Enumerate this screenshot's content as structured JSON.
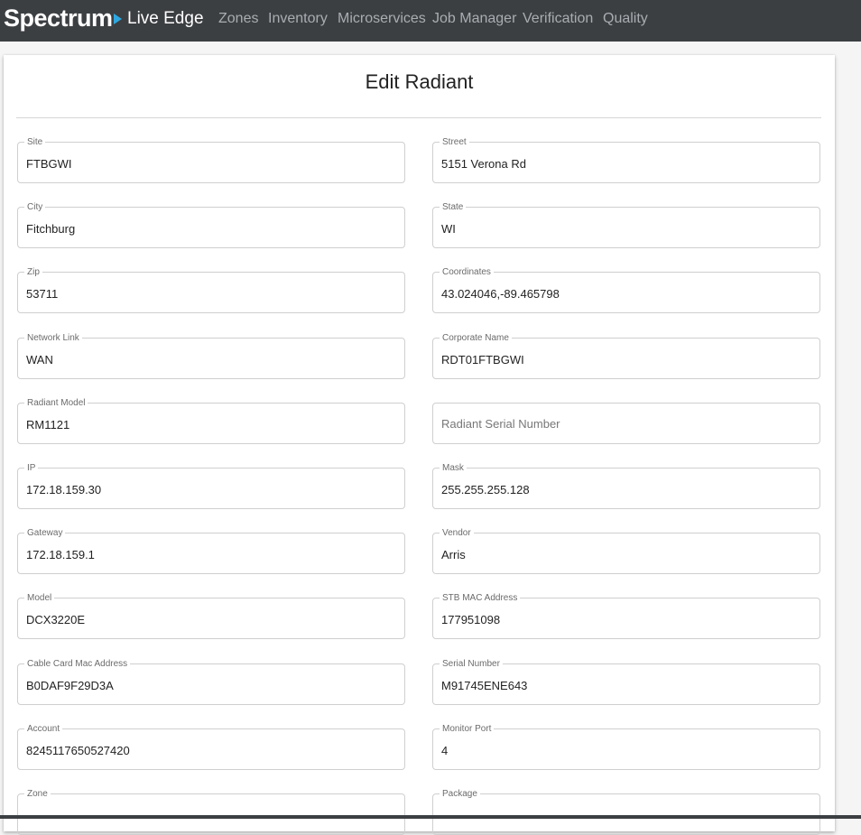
{
  "header": {
    "brand": "Spectrum",
    "product": "Live Edge",
    "nav": [
      "Zones",
      "Inventory",
      "Microservices",
      "Job Manager",
      "Verification",
      "Quality"
    ]
  },
  "page_title": "Edit Radiant",
  "fields": [
    {
      "label": "Site",
      "value": "FTBGWI",
      "placeholder": ""
    },
    {
      "label": "Street",
      "value": "5151 Verona Rd",
      "placeholder": ""
    },
    {
      "label": "City",
      "value": "Fitchburg",
      "placeholder": ""
    },
    {
      "label": "State",
      "value": "WI",
      "placeholder": ""
    },
    {
      "label": "Zip",
      "value": "53711",
      "placeholder": ""
    },
    {
      "label": "Coordinates",
      "value": "43.024046,-89.465798",
      "placeholder": ""
    },
    {
      "label": "Network Link",
      "value": "WAN",
      "placeholder": ""
    },
    {
      "label": "Corporate Name",
      "value": "RDT01FTBGWI",
      "placeholder": ""
    },
    {
      "label": "Radiant Model",
      "value": "RM1121",
      "placeholder": ""
    },
    {
      "label": "",
      "value": "",
      "placeholder": "Radiant Serial Number"
    },
    {
      "label": "IP",
      "value": "172.18.159.30",
      "placeholder": ""
    },
    {
      "label": "Mask",
      "value": "255.255.255.128",
      "placeholder": ""
    },
    {
      "label": "Gateway",
      "value": "172.18.159.1",
      "placeholder": ""
    },
    {
      "label": "Vendor",
      "value": "Arris",
      "placeholder": ""
    },
    {
      "label": "Model",
      "value": "DCX3220E",
      "placeholder": ""
    },
    {
      "label": "STB MAC Address",
      "value": "177951098",
      "placeholder": ""
    },
    {
      "label": "Cable Card Mac Address",
      "value": "B0DAF9F29D3A",
      "placeholder": ""
    },
    {
      "label": "Serial Number",
      "value": "M91745ENE643",
      "placeholder": ""
    },
    {
      "label": "Account",
      "value": "8245117650527420",
      "placeholder": ""
    },
    {
      "label": "Monitor Port",
      "value": "4",
      "placeholder": ""
    },
    {
      "label": "Zone",
      "value": "",
      "placeholder": ""
    },
    {
      "label": "Package",
      "value": "",
      "placeholder": ""
    }
  ]
}
